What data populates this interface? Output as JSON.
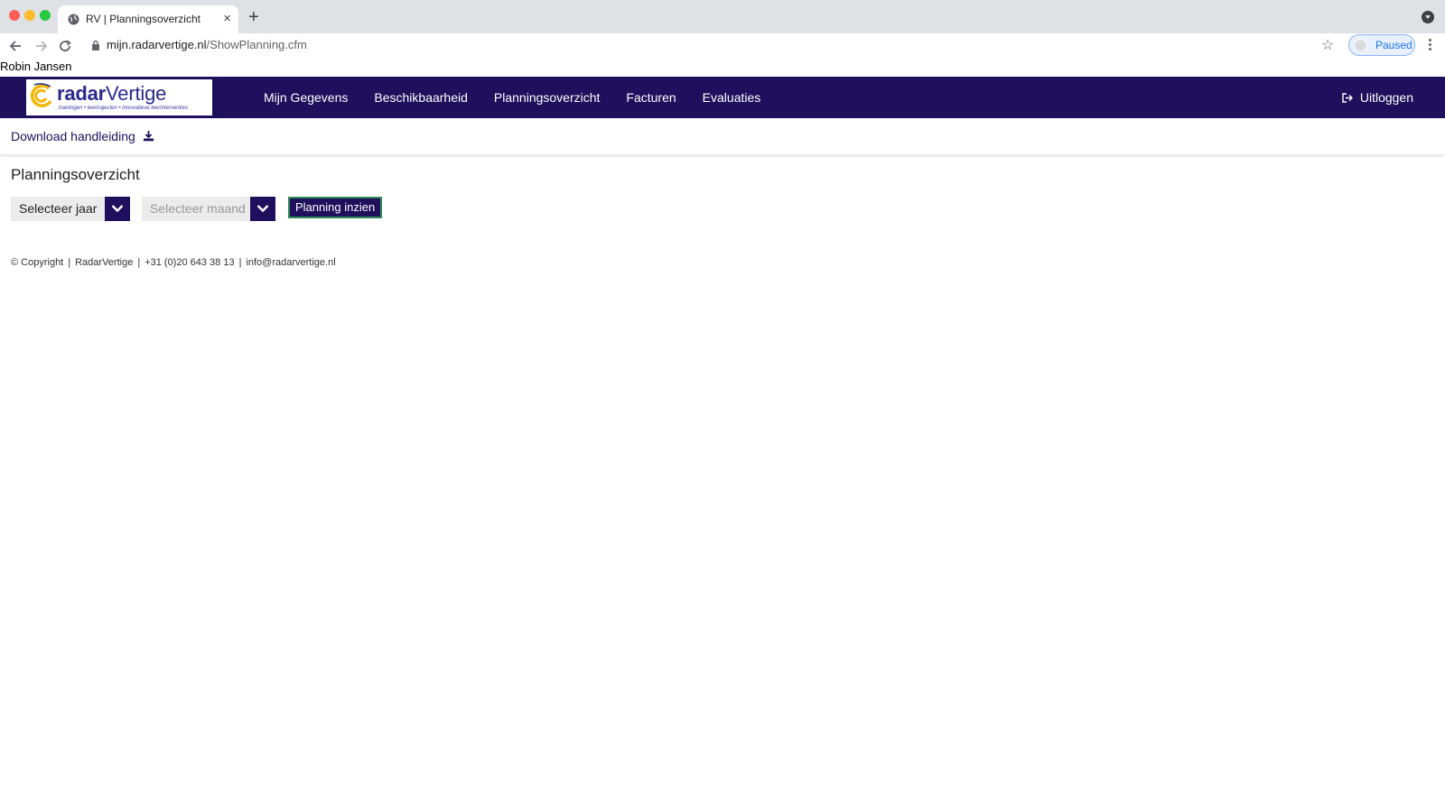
{
  "browser": {
    "tab_title": "RV | Planningsoverzicht",
    "url_host": "mijn.radarvertige.nl",
    "url_path": "/ShowPlanning.cfm",
    "profile_label": "Paused"
  },
  "user": {
    "name": "Robin Jansen"
  },
  "header": {
    "logo_text_bold": "radar",
    "logo_text_light": "Vertige",
    "logo_tagline": "trainingen • leertrajecten • innovatieve leerinterventies",
    "nav": [
      "Mijn Gegevens",
      "Beschikbaarheid",
      "Planningsoverzicht",
      "Facturen",
      "Evaluaties"
    ],
    "logout_label": "Uitloggen"
  },
  "subbar": {
    "download_label": "Download handleiding"
  },
  "main": {
    "title": "Planningsoverzicht",
    "year_select": "Selecteer jaar",
    "month_select": "Selecteer maand",
    "submit_label": "Planning inzien"
  },
  "footer": {
    "copyright": "© Copyright",
    "company": "RadarVertige",
    "phone": "+31 (0)20 643 38 13",
    "email": "info@radarvertige.nl"
  },
  "colors": {
    "brand_navy": "#1f0f5c",
    "button_border": "#2e8b57"
  }
}
